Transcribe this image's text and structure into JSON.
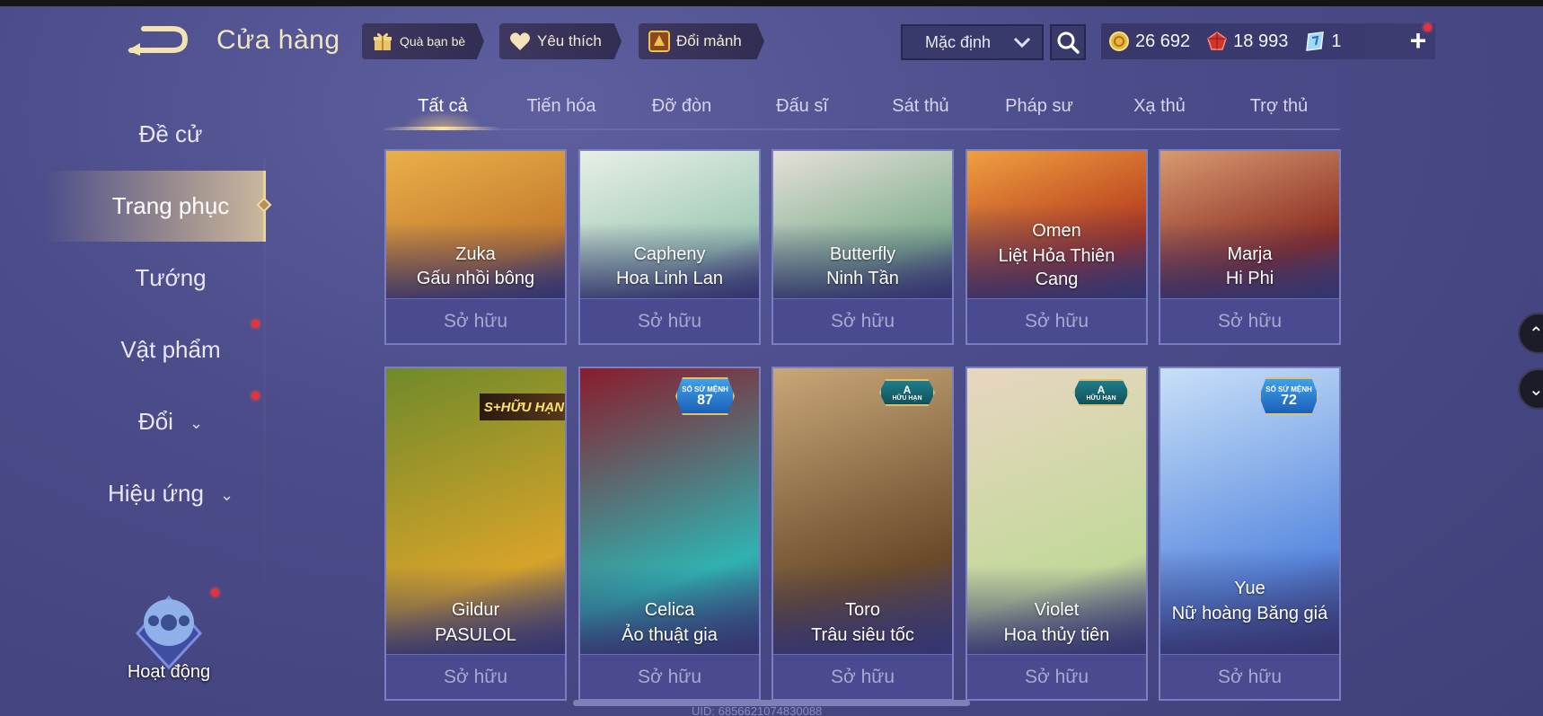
{
  "header": {
    "title": "Cửa hàng",
    "buttons": [
      {
        "label": "Quà bạn bè",
        "icon": "gift-icon"
      },
      {
        "label": "Yêu thích",
        "icon": "heart-icon"
      },
      {
        "label": "Đổi mảnh",
        "icon": "fragment-icon"
      }
    ],
    "sort_label": "Mặc định",
    "currencies": [
      {
        "value": "26 692",
        "icon": "gold-coin-icon"
      },
      {
        "value": "18 993",
        "icon": "ruby-icon"
      },
      {
        "value": "1",
        "icon": "voucher-icon"
      }
    ]
  },
  "sidebar": {
    "items": [
      {
        "label": "Đề cử"
      },
      {
        "label": "Trang phục",
        "active": true
      },
      {
        "label": "Tướng"
      },
      {
        "label": "Vật phẩm"
      },
      {
        "label": "Đổi"
      },
      {
        "label": "Hiệu ứng"
      }
    ],
    "activity_label": "Hoạt động"
  },
  "tabs": [
    "Tất cả",
    "Tiến hóa",
    "Đỡ đòn",
    "Đấu sĩ",
    "Sát thủ",
    "Pháp sư",
    "Xạ thủ",
    "Trợ thủ"
  ],
  "owned_label": "Sở hữu",
  "row1": [
    {
      "hero": "Zuka",
      "skin": "Gấu nhồi bông",
      "colors": [
        "#c47a2c",
        "#e9b04a"
      ]
    },
    {
      "hero": "Capheny",
      "skin": "Hoa Linh Lan",
      "colors": [
        "#9fc9b5",
        "#e8efe6"
      ]
    },
    {
      "hero": "Butterfly",
      "skin": "Ninh Tần",
      "colors": [
        "#7fae8e",
        "#e6e0d8"
      ]
    },
    {
      "hero": "Omen",
      "skin": "Liệt Hỏa Thiên Cang",
      "colors": [
        "#b2341a",
        "#f0a040"
      ]
    },
    {
      "hero": "Marja",
      "skin": "Hi Phi",
      "colors": [
        "#8a2c22",
        "#d89a70"
      ]
    }
  ],
  "row2": [
    {
      "hero": "Gildur",
      "skin": "PASULOL",
      "colors": [
        "#d7a32a",
        "#6f8a2a"
      ],
      "badge": "S+HỮU HẠN"
    },
    {
      "hero": "Celica",
      "skin": "Ảo thuật gia",
      "colors": [
        "#2fb2b0",
        "#8a1c2c"
      ],
      "badge_title": "SỐ SỨ MỆNH",
      "badge_value": "87"
    },
    {
      "hero": "Toro",
      "skin": "Trâu siêu tốc",
      "colors": [
        "#6a4a2a",
        "#c8a878"
      ],
      "badge_a": "A",
      "badge_a_sub": "HỮU HẠN"
    },
    {
      "hero": "Violet",
      "skin": "Hoa thủy tiên",
      "colors": [
        "#c2d89a",
        "#e8d6c0"
      ],
      "badge_a": "A",
      "badge_a_sub": "HỮU HẠN"
    },
    {
      "hero": "Yue",
      "skin": "Nữ hoàng Băng giá",
      "colors": [
        "#5a8ae0",
        "#c8e0f8"
      ],
      "badge_title": "SỐ SỨ MỆNH",
      "badge_value": "72"
    }
  ],
  "footer_uid": "UID: 6856621074830088"
}
